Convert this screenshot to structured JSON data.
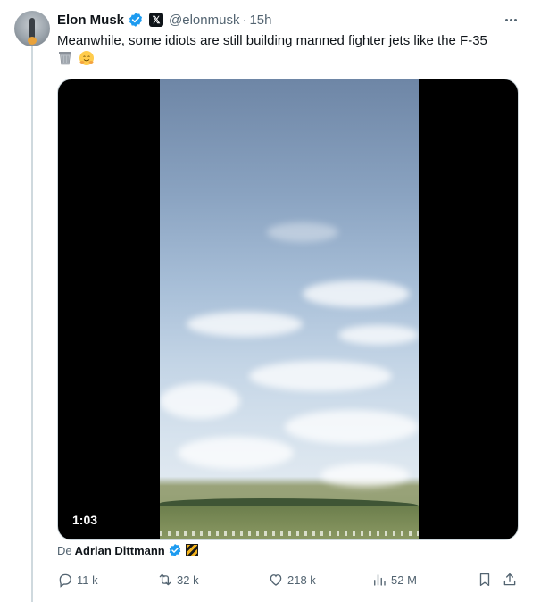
{
  "tweet": {
    "author_name": "Elon Musk",
    "handle": "@elonmusk",
    "separator": "·",
    "time": "15h",
    "text": "Meanwhile, some idiots are still building manned fighter jets like the F-35",
    "emojis": [
      "wastebasket-icon",
      "hugging-face-icon"
    ]
  },
  "media": {
    "duration": "1:03"
  },
  "credit": {
    "prefix": "De",
    "name": "Adrian Dittmann"
  },
  "actions": {
    "replies": "11 k",
    "reposts": "32 k",
    "likes": "218 k",
    "views": "52 M"
  },
  "colors": {
    "verified_blue": "#1d9bf0",
    "secondary_text": "#536471"
  }
}
